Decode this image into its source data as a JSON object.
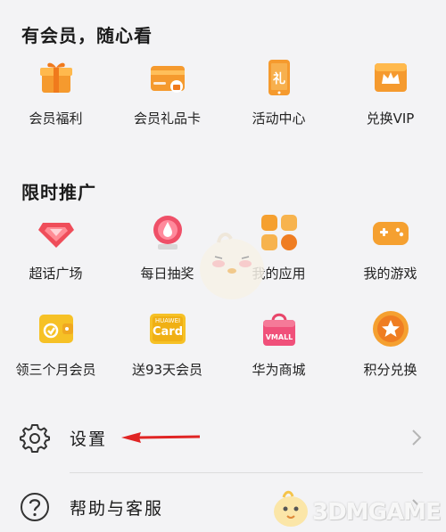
{
  "member_section": {
    "title": "有会员，随心看",
    "items": [
      {
        "label": "会员福利",
        "icon": "gift-icon"
      },
      {
        "label": "会员礼品卡",
        "icon": "gift-card-icon"
      },
      {
        "label": "活动中心",
        "icon": "activity-phone-icon"
      },
      {
        "label": "兑换VIP",
        "icon": "crown-exchange-icon"
      }
    ]
  },
  "promo_section": {
    "title": "限时推广",
    "items": [
      {
        "label": "超话广场",
        "icon": "diamond-icon"
      },
      {
        "label": "每日抽奖",
        "icon": "lottery-icon"
      },
      {
        "label": "我的应用",
        "icon": "apps-grid-icon"
      },
      {
        "label": "我的游戏",
        "icon": "gamepad-icon"
      },
      {
        "label": "领三个月会员",
        "icon": "wallet-icon"
      },
      {
        "label": "送93天会员",
        "icon": "huawei-card-icon",
        "badge_top": "HUAWEI",
        "badge_main": "Card"
      },
      {
        "label": "华为商城",
        "icon": "vmall-bag-icon",
        "badge_main": "VMALL"
      },
      {
        "label": "积分兑换",
        "icon": "star-coin-icon"
      }
    ]
  },
  "menu": {
    "settings_label": "设置",
    "help_label": "帮助与客服"
  },
  "watermark": {
    "text": "3DMGAME"
  },
  "colors": {
    "orange": "#f5a030",
    "deep_orange": "#ef7d22",
    "red_arrow": "#e02424"
  }
}
